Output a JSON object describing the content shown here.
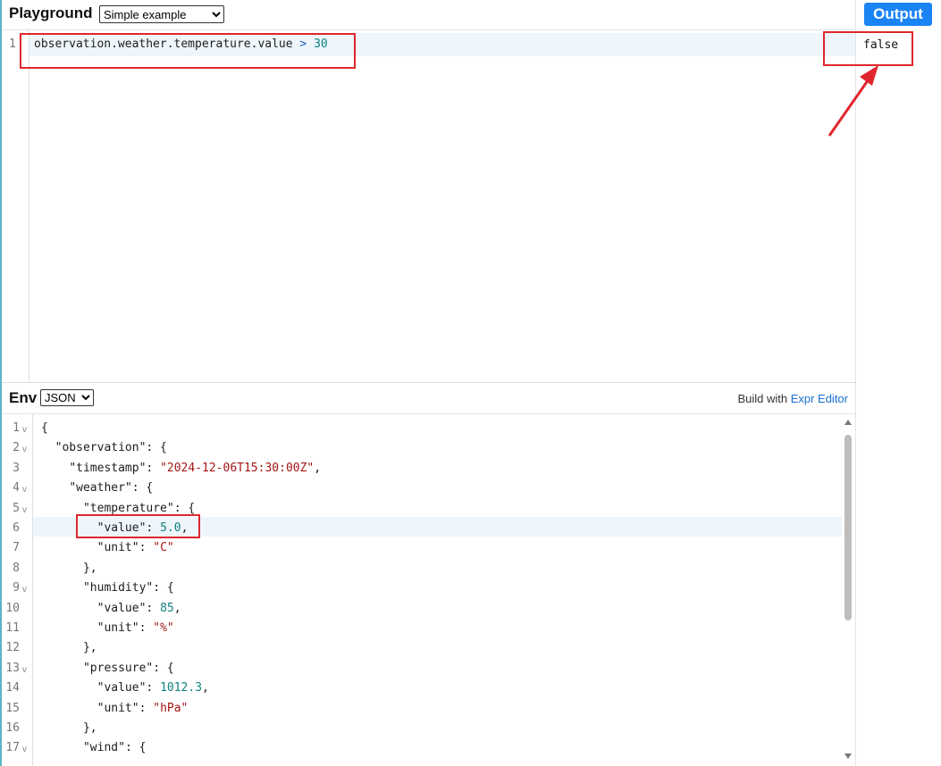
{
  "header": {
    "title": "Playground",
    "example_selected": "Simple example",
    "output_button": "Output"
  },
  "expression": {
    "line_number": "1",
    "parts": [
      "observation.weather.temperature.value",
      " > ",
      "30"
    ]
  },
  "output": {
    "value": "false"
  },
  "env": {
    "title": "Env",
    "format_selected": "JSON",
    "build_with_prefix": "Build with ",
    "build_with_link": "Expr Editor"
  },
  "json_lines": [
    {
      "no": "1",
      "fold": true
    },
    {
      "no": "2",
      "fold": true
    },
    {
      "no": "3",
      "fold": false
    },
    {
      "no": "4",
      "fold": true
    },
    {
      "no": "5",
      "fold": true
    },
    {
      "no": "6",
      "fold": false
    },
    {
      "no": "7",
      "fold": false
    },
    {
      "no": "8",
      "fold": false
    },
    {
      "no": "9",
      "fold": true
    },
    {
      "no": "10",
      "fold": false
    },
    {
      "no": "11",
      "fold": false
    },
    {
      "no": "12",
      "fold": false
    },
    {
      "no": "13",
      "fold": true
    },
    {
      "no": "14",
      "fold": false
    },
    {
      "no": "15",
      "fold": false
    },
    {
      "no": "16",
      "fold": false
    },
    {
      "no": "17",
      "fold": true
    }
  ],
  "json_code": {
    "l1": "{",
    "l2_key": "\"observation\"",
    "l2_rest": ": {",
    "l3_key": "\"timestamp\"",
    "l3_sep": ": ",
    "l3_val": "\"2024-12-06T15:30:00Z\"",
    "l3_end": ",",
    "l4_key": "\"weather\"",
    "l4_rest": ": {",
    "l5_key": "\"temperature\"",
    "l5_rest": ": {",
    "l6_key": "\"value\"",
    "l6_sep": ": ",
    "l6_val": "5.0",
    "l6_end": ",",
    "l7_key": "\"unit\"",
    "l7_sep": ": ",
    "l7_val": "\"C\"",
    "l8": "},",
    "l9_key": "\"humidity\"",
    "l9_rest": ": {",
    "l10_key": "\"value\"",
    "l10_sep": ": ",
    "l10_val": "85",
    "l10_end": ",",
    "l11_key": "\"unit\"",
    "l11_sep": ": ",
    "l11_val": "\"%\"",
    "l12": "},",
    "l13_key": "\"pressure\"",
    "l13_rest": ": {",
    "l14_key": "\"value\"",
    "l14_sep": ": ",
    "l14_val": "1012.3",
    "l14_end": ",",
    "l15_key": "\"unit\"",
    "l15_sep": ": ",
    "l15_val": "\"hPa\"",
    "l16": "},",
    "l17_key": "\"wind\"",
    "l17_rest": ": {"
  },
  "colors": {
    "annotation": "#e0262d",
    "accent": "#1b84f5"
  }
}
